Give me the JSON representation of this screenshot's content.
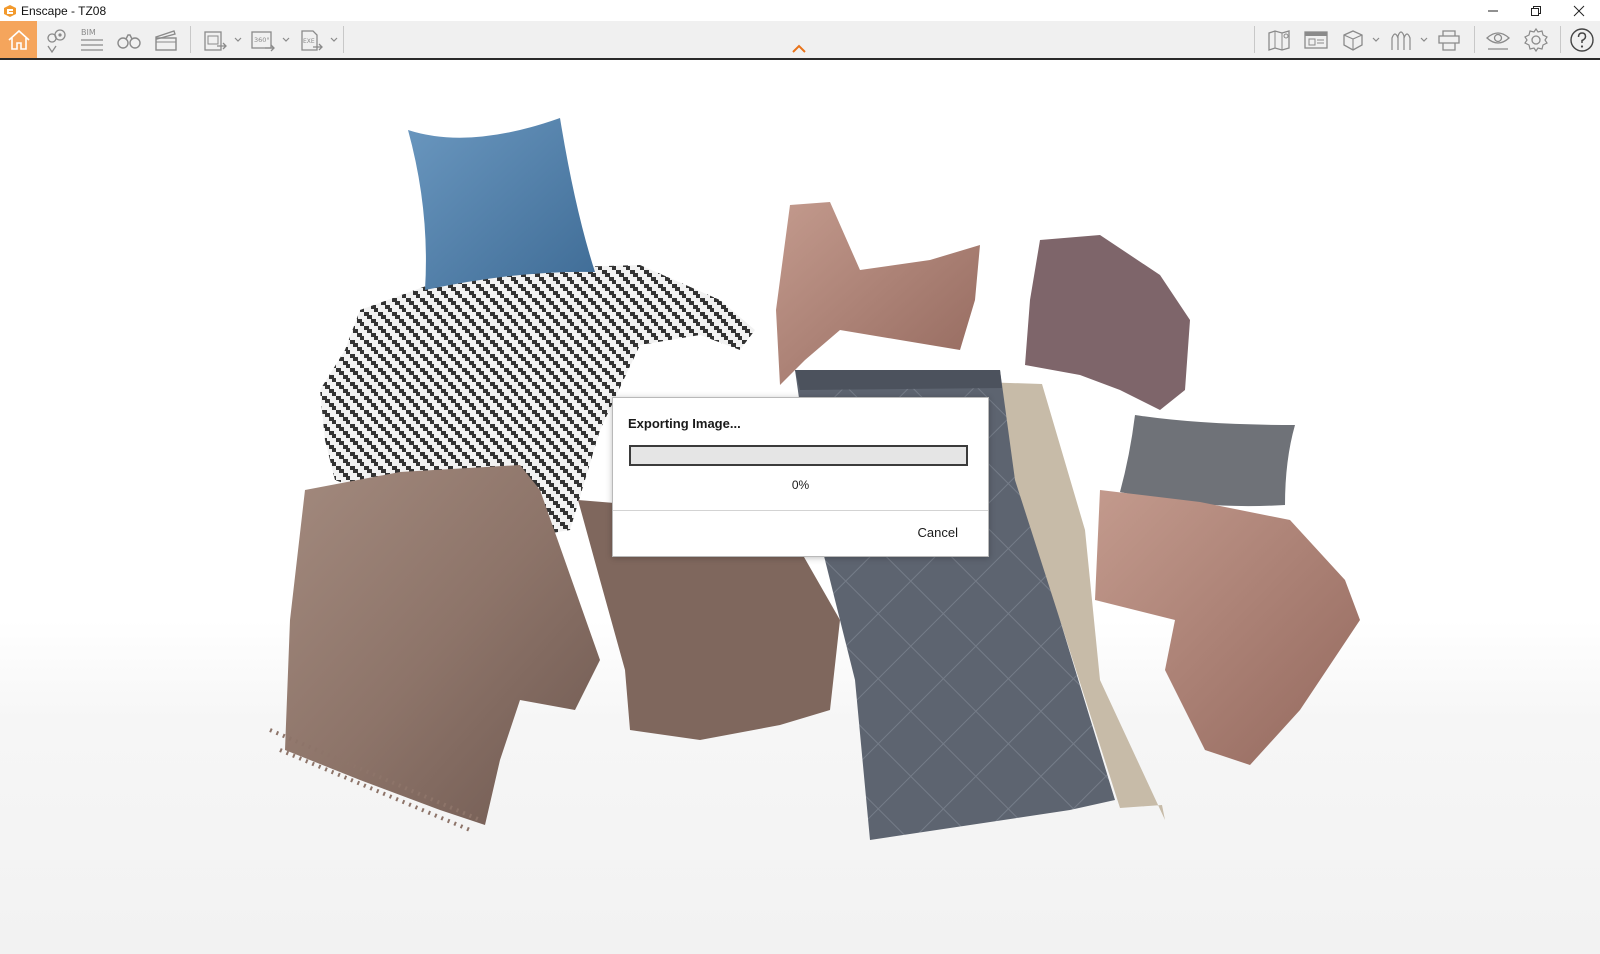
{
  "window": {
    "title": "Enscape - TZ08",
    "controls": [
      "minimize-icon",
      "restore-icon",
      "close-icon"
    ]
  },
  "toolbar": {
    "left_tools": [
      "home-icon",
      "views-icon",
      "bim-icon",
      "binoculars-icon",
      "clapper-icon",
      "render-image-icon",
      "render-360-icon",
      "export-exe-icon"
    ],
    "bim_label": "BIM",
    "pano_label": "360°",
    "exe_label": "EXE",
    "right_tools": [
      "map-icon",
      "asset-library-icon",
      "view-cube-icon",
      "material-icon",
      "upload-icon",
      "visual-settings-icon",
      "settings-gear-icon",
      "help-icon"
    ],
    "active_tool": "home-icon",
    "accent_color": "#f5a55c"
  },
  "dialog": {
    "title": "Exporting Image...",
    "progress": 0,
    "progress_text": "0%",
    "cancel_label": "Cancel"
  },
  "scene": {
    "description_icons": [
      "blue-pillow",
      "houndstooth-throw",
      "taupe-blanket",
      "pink-throw",
      "mauve-knit-throw",
      "grey-quilt",
      "grey-pillow"
    ],
    "colors": {
      "blue_pillow": "#4f7ea8",
      "taupe": "#8d7469",
      "pink_cloth": "#b3867a",
      "grey_quilt": "#5d6470",
      "beige": "#c7bba8",
      "mauve_knit": "#7e656a",
      "grey_pillow": "#6f7278"
    }
  }
}
